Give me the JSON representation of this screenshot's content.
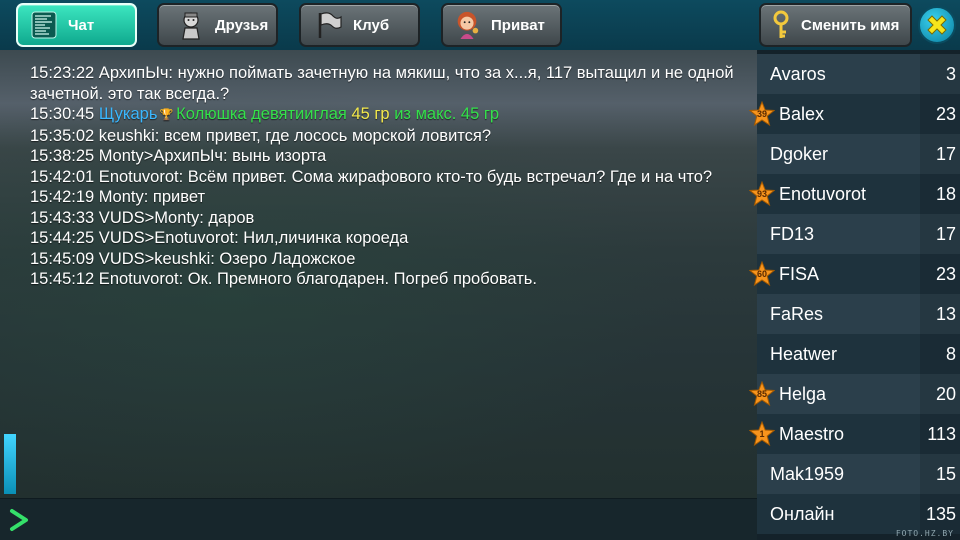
{
  "tabs": {
    "chat": "Чат",
    "friends": "Друзья",
    "club": "Клуб",
    "private": "Приват",
    "rename": "Сменить имя"
  },
  "colors": {
    "active_tab": "#1fc9a6",
    "nick_blue": "#3ab7ff",
    "fish_green": "#34e14a",
    "weight_yellow": "#f4e94c",
    "star_orange": "#f7941d"
  },
  "icons": {
    "chat_tab": "chat-lines-icon",
    "friends_tab": "fisherman-icon",
    "club_tab": "flag-icon",
    "private_tab": "girl-icon",
    "rename_tab": "key-icon",
    "close": "close-x-icon",
    "send": "chevron-right-icon",
    "rank": "star-icon"
  },
  "messages": [
    {
      "text": "15:23:22 АрхипЫч: нужно поймать зачетную на мякиш, что за х...я, 117 вытащил и не одной зачетной. это так всегда.?"
    },
    {
      "time": "15:30:45",
      "nick": "Щукарь",
      "fish": "Колюшка девятииглая",
      "weight": "45 гр",
      "max_label": "из макс.",
      "max_weight": "45 гр"
    },
    {
      "text": "15:35:02 keushki: всем привет, где лосось морской ловится?"
    },
    {
      "text": "15:38:25 Monty>АрхипЫч: вынь изорта"
    },
    {
      "text": "15:42:01 Enotuvorot: Всём привет. Сома жирафового кто-то будь встречал? Где и на что?"
    },
    {
      "text": "15:42:19 Monty: привет"
    },
    {
      "text": "15:43:33 VUDS>Monty: даров"
    },
    {
      "text": "15:44:25 VUDS>Enotuvorot: Нил,личинка короеда"
    },
    {
      "text": "15:45:09 VUDS>keushki: Озеро Ладожское"
    },
    {
      "text": "15:45:12 Enotuvorot: Ок. Премного благодарен. Погреб пробовать."
    }
  ],
  "input": {
    "value": "",
    "placeholder": ""
  },
  "users": [
    {
      "name": "Avaros",
      "count": "3",
      "rank": ""
    },
    {
      "name": "Balex",
      "count": "23",
      "rank": "39"
    },
    {
      "name": "Dgoker",
      "count": "17",
      "rank": ""
    },
    {
      "name": "Enotuvorot",
      "count": "18",
      "rank": "93"
    },
    {
      "name": "FD13",
      "count": "17",
      "rank": ""
    },
    {
      "name": "FISA",
      "count": "23",
      "rank": "60"
    },
    {
      "name": "FaRes",
      "count": "13",
      "rank": ""
    },
    {
      "name": "Heatwer",
      "count": "8",
      "rank": ""
    },
    {
      "name": "Helga",
      "count": "20",
      "rank": "85"
    },
    {
      "name": "Maestro",
      "count": "113",
      "rank": "1"
    },
    {
      "name": "Mak1959",
      "count": "15",
      "rank": ""
    },
    {
      "name": "Онлайн",
      "count": "135",
      "rank": ""
    }
  ],
  "watermark": "FOTO.HZ.BY"
}
